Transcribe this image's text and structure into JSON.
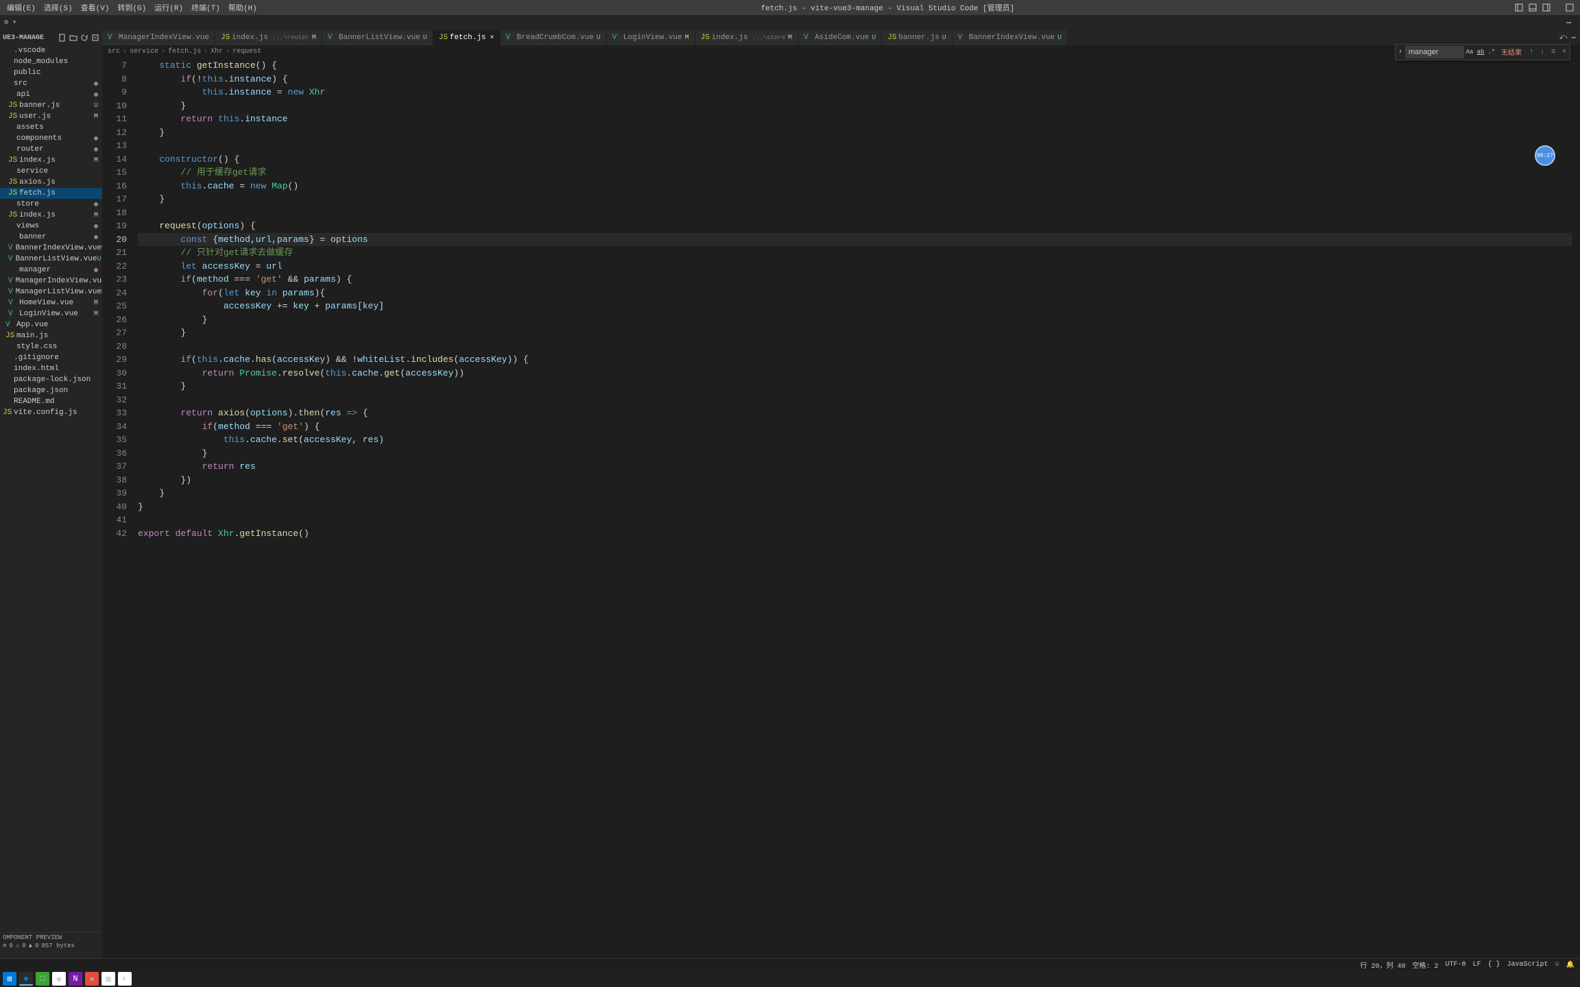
{
  "menu": [
    "编辑(E)",
    "选择(S)",
    "查看(V)",
    "转到(G)",
    "运行(R)",
    "终端(T)",
    "帮助(H)"
  ],
  "window_title": "fetch.js - vite-vue3-manage - Visual Studio Code [管理员]",
  "sidebar_header": "UE3-MANAGE",
  "tree": [
    {
      "name": ".vscode",
      "type": "folder"
    },
    {
      "name": "node_modules",
      "type": "folder"
    },
    {
      "name": "public",
      "type": "folder"
    },
    {
      "name": "src",
      "type": "folder",
      "dot": true
    },
    {
      "name": "api",
      "type": "folder",
      "indent": 1,
      "dot": true
    },
    {
      "name": "banner.js",
      "type": "js",
      "indent": 2,
      "status": "U"
    },
    {
      "name": "user.js",
      "type": "js",
      "indent": 2,
      "status": "M"
    },
    {
      "name": "assets",
      "type": "folder",
      "indent": 1
    },
    {
      "name": "components",
      "type": "folder",
      "indent": 1,
      "dot": true
    },
    {
      "name": "router",
      "type": "folder",
      "indent": 1,
      "dot": true
    },
    {
      "name": "index.js",
      "type": "js",
      "indent": 2,
      "status": "M"
    },
    {
      "name": "service",
      "type": "folder",
      "indent": 1
    },
    {
      "name": "axios.js",
      "type": "js",
      "indent": 2
    },
    {
      "name": "fetch.js",
      "type": "js",
      "indent": 2,
      "active": true
    },
    {
      "name": "store",
      "type": "folder",
      "indent": 1,
      "dot": true
    },
    {
      "name": "index.js",
      "type": "js",
      "indent": 2,
      "status": "M"
    },
    {
      "name": "views",
      "type": "folder",
      "indent": 1,
      "dot": true
    },
    {
      "name": "banner",
      "type": "folder",
      "indent": 2,
      "dot": true
    },
    {
      "name": "BannerIndexView.vue",
      "type": "vue",
      "indent": 2,
      "status": "U"
    },
    {
      "name": "BannerListView.vue",
      "type": "vue",
      "indent": 2,
      "status": "U"
    },
    {
      "name": "manager",
      "type": "folder",
      "indent": 2,
      "dot": true
    },
    {
      "name": "ManagerIndexView.vue",
      "type": "vue",
      "indent": 2
    },
    {
      "name": "ManagerListView.vue",
      "type": "vue",
      "indent": 2,
      "status": "M"
    },
    {
      "name": "HomeView.vue",
      "type": "vue",
      "indent": 2,
      "status": "M"
    },
    {
      "name": "LoginView.vue",
      "type": "vue",
      "indent": 2,
      "status": "M"
    },
    {
      "name": "App.vue",
      "type": "vue",
      "indent": 1
    },
    {
      "name": "main.js",
      "type": "js",
      "indent": 1
    },
    {
      "name": "style.css",
      "type": "file",
      "indent": 1
    },
    {
      "name": ".gitignore",
      "type": "file"
    },
    {
      "name": "index.html",
      "type": "file"
    },
    {
      "name": "package-lock.json",
      "type": "file"
    },
    {
      "name": "package.json",
      "type": "file"
    },
    {
      "name": "README.md",
      "type": "file"
    },
    {
      "name": "vite.config.js",
      "type": "js"
    }
  ],
  "component_preview": {
    "title": "OMPONENT PREVIEW",
    "stats": [
      "0",
      "0",
      "0",
      "857 bytes"
    ]
  },
  "tabs": [
    {
      "name": "ManagerIndexView.vue",
      "type": "vue"
    },
    {
      "name": "index.js",
      "type": "js",
      "suffix": "...\\router",
      "status": "M"
    },
    {
      "name": "BannerListView.vue",
      "type": "vue",
      "status": "U"
    },
    {
      "name": "fetch.js",
      "type": "js",
      "active": true,
      "close": true
    },
    {
      "name": "BreadCrumbCom.vue",
      "type": "vue",
      "status": "U"
    },
    {
      "name": "LoginView.vue",
      "type": "vue",
      "status": "M"
    },
    {
      "name": "index.js",
      "type": "js",
      "suffix": "...\\store",
      "status": "M"
    },
    {
      "name": "AsideCom.vue",
      "type": "vue",
      "status": "U"
    },
    {
      "name": "banner.js",
      "type": "js",
      "status": "U"
    },
    {
      "name": "BannerIndexView.vue",
      "type": "vue",
      "status": "U"
    }
  ],
  "breadcrumb": [
    "src",
    "service",
    "fetch.js",
    "Xhr",
    "request"
  ],
  "find": {
    "value": "manager",
    "result": "无结果"
  },
  "floating_badge": "00:27",
  "code_lines": [
    {
      "n": 7,
      "html": "    <span class='kw'>static</span> <span class='fn'>getInstance</span><span class='pun'>()</span> <span class='pun'>{</span>"
    },
    {
      "n": 8,
      "html": "        <span class='kw2'>if</span><span class='pun'>(</span><span class='op'>!</span><span class='this'>this</span><span class='pun'>.</span><span class='prop'>instance</span><span class='pun'>)</span> <span class='pun'>{</span>"
    },
    {
      "n": 9,
      "html": "            <span class='this'>this</span><span class='pun'>.</span><span class='prop'>instance</span> <span class='op'>=</span> <span class='kw'>new</span> <span class='cls'>Xhr</span>"
    },
    {
      "n": 10,
      "html": "        <span class='pun'>}</span>"
    },
    {
      "n": 11,
      "html": "        <span class='kw2'>return</span> <span class='this'>this</span><span class='pun'>.</span><span class='prop'>instance</span>"
    },
    {
      "n": 12,
      "html": "    <span class='pun'>}</span>"
    },
    {
      "n": 13,
      "html": ""
    },
    {
      "n": 14,
      "html": "    <span class='kw'>constructor</span><span class='pun'>()</span> <span class='pun'>{</span>"
    },
    {
      "n": 15,
      "html": "        <span class='com'>// 用于缓存get请求</span>"
    },
    {
      "n": 16,
      "html": "        <span class='this'>this</span><span class='pun'>.</span><span class='prop'>cache</span> <span class='op'>=</span> <span class='kw'>new</span> <span class='cls'>Map</span><span class='pun'>()</span>"
    },
    {
      "n": 17,
      "html": "    <span class='pun'>}</span>"
    },
    {
      "n": 18,
      "html": ""
    },
    {
      "n": 19,
      "html": "    <span class='fn'>request</span><span class='pun'>(</span><span class='var'>options</span><span class='pun'>)</span> <span class='pun'>{</span>"
    },
    {
      "n": 20,
      "html": "        <span class='kw'>const</span> <span class='pun'>{</span><span class='var'>method</span><span class='pun'>,</span><span class='var'>url</span><span class='pun'>,</span><span class='var'>params</span><span class='pun'>}</span> <span class='op'>=</span> <span class='var'>options</span>",
      "current": true
    },
    {
      "n": 21,
      "html": "        <span class='com'>// 只针对get请求去做缓存</span>"
    },
    {
      "n": 22,
      "html": "        <span class='kw'>let</span> <span class='var'>accessKey</span> <span class='op'>=</span> <span class='var'>url</span>"
    },
    {
      "n": 23,
      "html": "        <span class='kw2'>if</span><span class='pun'>(</span><span class='var'>method</span> <span class='op'>===</span> <span class='str'>'get'</span> <span class='op'>&&</span> <span class='var'>params</span><span class='pun'>)</span> <span class='pun'>{</span>"
    },
    {
      "n": 24,
      "html": "            <span class='kw2'>for</span><span class='pun'>(</span><span class='kw'>let</span> <span class='var'>key</span> <span class='kw'>in</span> <span class='var'>params</span><span class='pun'>){</span>"
    },
    {
      "n": 25,
      "html": "                <span class='var'>accessKey</span> <span class='op'>+=</span> <span class='var'>key</span> <span class='op'>+</span> <span class='var'>params</span><span class='pun'>[</span><span class='var'>key</span><span class='pun'>]</span>"
    },
    {
      "n": 26,
      "html": "            <span class='pun'>}</span>"
    },
    {
      "n": 27,
      "html": "        <span class='pun'>}</span>"
    },
    {
      "n": 28,
      "html": ""
    },
    {
      "n": 29,
      "html": "        <span class='kw2'>if</span><span class='pun'>(</span><span class='this'>this</span><span class='pun'>.</span><span class='prop'>cache</span><span class='pun'>.</span><span class='fn'>has</span><span class='pun'>(</span><span class='var'>accessKey</span><span class='pun'>)</span> <span class='op'>&&</span> <span class='op'>!</span><span class='var'>whiteList</span><span class='pun'>.</span><span class='fn'>includes</span><span class='pun'>(</span><span class='var'>accessKey</span><span class='pun'>))</span> <span class='pun'>{</span>"
    },
    {
      "n": 30,
      "html": "            <span class='kw2'>return</span> <span class='cls'>Promise</span><span class='pun'>.</span><span class='fn'>resolve</span><span class='pun'>(</span><span class='this'>this</span><span class='pun'>.</span><span class='prop'>cache</span><span class='pun'>.</span><span class='fn'>get</span><span class='pun'>(</span><span class='var'>accessKey</span><span class='pun'>))</span>"
    },
    {
      "n": 31,
      "html": "        <span class='pun'>}</span>"
    },
    {
      "n": 32,
      "html": ""
    },
    {
      "n": 33,
      "html": "        <span class='kw2'>return</span> <span class='fn'>axios</span><span class='pun'>(</span><span class='var'>options</span><span class='pun'>).</span><span class='fn'>then</span><span class='pun'>(</span><span class='var'>res</span> <span class='kw'>=></span> <span class='pun'>{</span>"
    },
    {
      "n": 34,
      "html": "            <span class='kw2'>if</span><span class='pun'>(</span><span class='var'>method</span> <span class='op'>===</span> <span class='str'>'get'</span><span class='pun'>)</span> <span class='pun'>{</span>"
    },
    {
      "n": 35,
      "html": "                <span class='this'>this</span><span class='pun'>.</span><span class='prop'>cache</span><span class='pun'>.</span><span class='fn'>set</span><span class='pun'>(</span><span class='var'>accessKey</span><span class='pun'>,</span> <span class='var'>res</span><span class='pun'>)</span>"
    },
    {
      "n": 36,
      "html": "            <span class='pun'>}</span>"
    },
    {
      "n": 37,
      "html": "            <span class='kw2'>return</span> <span class='var'>res</span>"
    },
    {
      "n": 38,
      "html": "        <span class='pun'>})</span>"
    },
    {
      "n": 39,
      "html": "    <span class='pun'>}</span>"
    },
    {
      "n": 40,
      "html": "<span class='pun'>}</span>"
    },
    {
      "n": 41,
      "html": ""
    },
    {
      "n": 42,
      "html": "<span class='kw2'>export</span> <span class='kw2'>default</span> <span class='cls'>Xhr</span><span class='pun'>.</span><span class='fn'>getInstance</span><span class='pun'>()</span>"
    }
  ],
  "status": {
    "position": "行 20，列 40",
    "spaces": "空格: 2",
    "encoding": "UTF-8",
    "eol": "LF",
    "lang": "JavaScript"
  }
}
